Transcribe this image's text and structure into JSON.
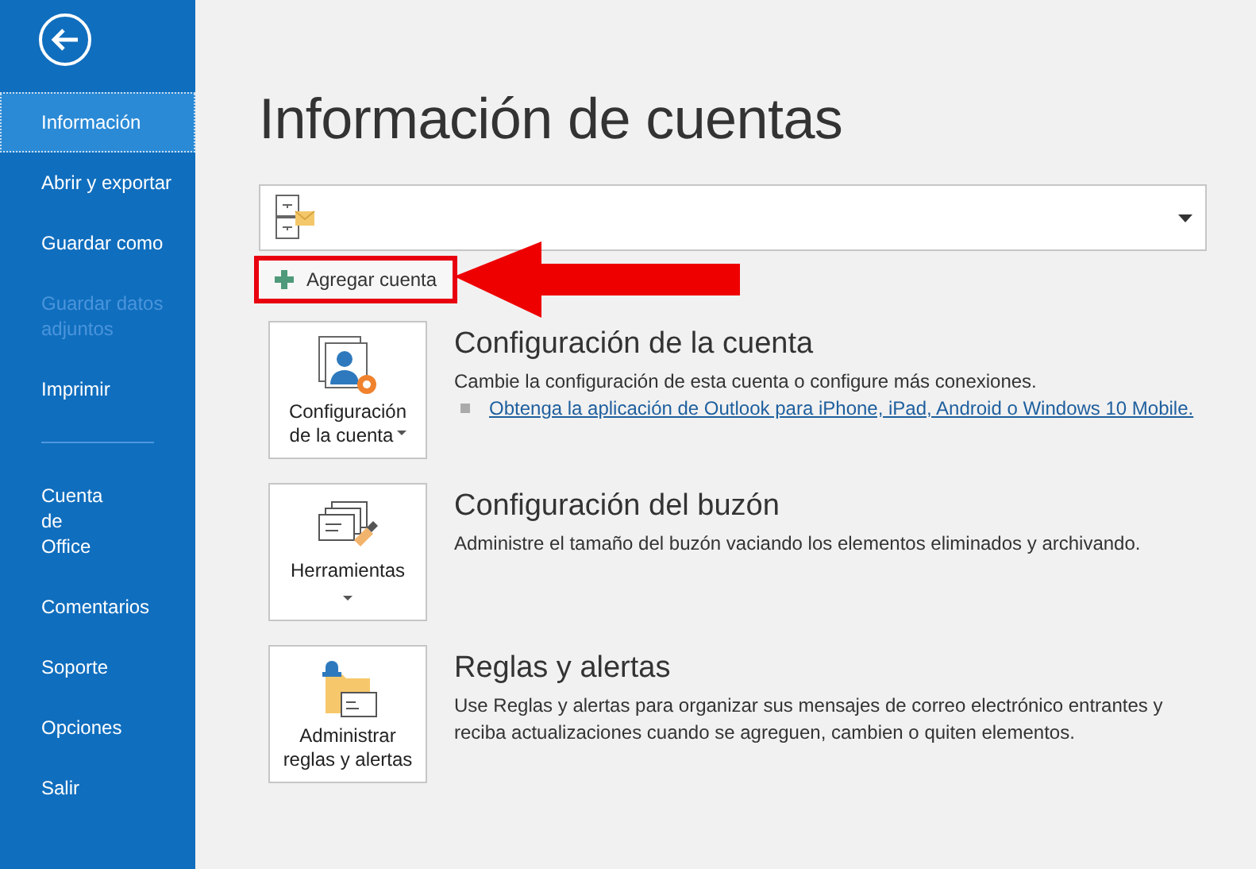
{
  "sidebar": {
    "items": [
      {
        "kind": "item",
        "label": "Información",
        "selected": true,
        "disabled": false
      },
      {
        "kind": "item",
        "label": "Abrir y exportar",
        "selected": false,
        "disabled": false
      },
      {
        "kind": "item",
        "label": "Guardar como",
        "selected": false,
        "disabled": false
      },
      {
        "kind": "item",
        "label": "Guardar datos adjuntos",
        "selected": false,
        "disabled": true
      },
      {
        "kind": "item",
        "label": "Imprimir",
        "selected": false,
        "disabled": false
      },
      {
        "kind": "separator"
      },
      {
        "kind": "item",
        "label": "Cuenta\nde\nOffice",
        "selected": false,
        "disabled": false
      },
      {
        "kind": "item",
        "label": "Comentarios",
        "selected": false,
        "disabled": false
      },
      {
        "kind": "item",
        "label": "Soporte",
        "selected": false,
        "disabled": false
      },
      {
        "kind": "item",
        "label": "Opciones",
        "selected": false,
        "disabled": false
      },
      {
        "kind": "item",
        "label": "Salir",
        "selected": false,
        "disabled": false
      }
    ]
  },
  "title": "Información de cuentas",
  "add_account": {
    "label": "Agregar cuenta",
    "highlighted": true
  },
  "sections": [
    {
      "kind": "account",
      "button": "Configuración\nde la cuenta",
      "has_caret": true,
      "heading": "Configuración de la cuenta",
      "text": "Cambie la configuración de esta cuenta o configure más conexiones.",
      "link": "Obtenga la aplicación de Outlook para iPhone, iPad, Android o Windows 10 Mobile."
    },
    {
      "kind": "tools",
      "button": "Herramientas",
      "has_caret": true,
      "heading": "Configuración del buzón",
      "text": "Administre el tamaño del buzón vaciando los elementos eliminados y archivando."
    },
    {
      "kind": "rules",
      "button": "Administrar\nreglas y alertas",
      "has_caret": false,
      "heading": "Reglas y alertas",
      "text": "Use Reglas y alertas para organizar sus mensajes de correo electrónico entrantes y reciba actualizaciones cuando se agreguen, cambien o quiten elementos."
    }
  ]
}
